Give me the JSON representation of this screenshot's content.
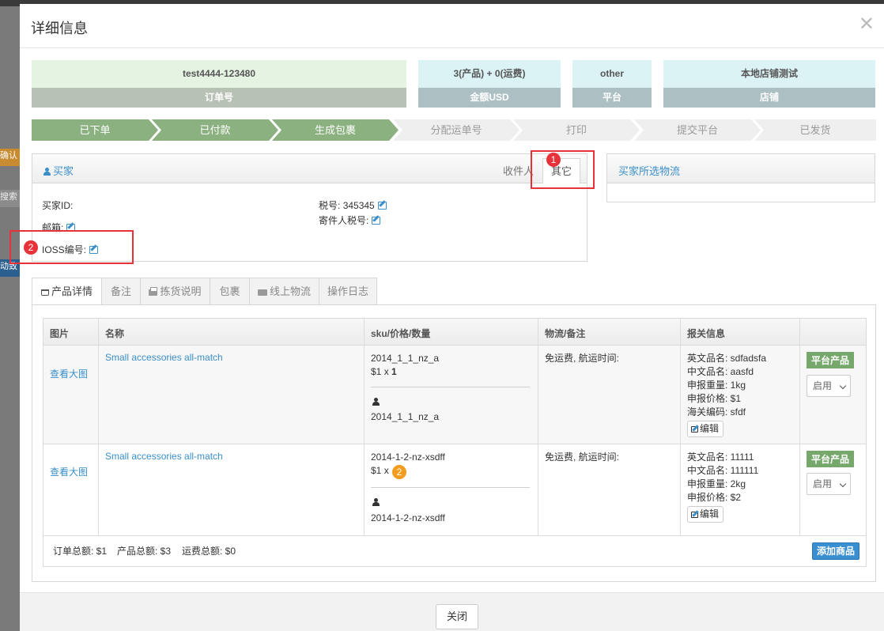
{
  "backdrop": {
    "side_items": [
      "确认",
      "搜索",
      "动致"
    ]
  },
  "modal": {
    "title": "详细信息",
    "close_symbol": "✕"
  },
  "summary": [
    {
      "value": "test4444-123480",
      "label": "订单号"
    },
    {
      "value": "3(产品) + 0(运费)",
      "label": "金额USD"
    },
    {
      "value": "other",
      "label": "平台"
    },
    {
      "value": "本地店铺测试",
      "label": "店铺"
    }
  ],
  "steps": [
    "已下单",
    "已付款",
    "生成包裹",
    "分配运单号",
    "打印",
    "提交平台",
    "已发货"
  ],
  "buyer": {
    "title": "买家",
    "tabs": [
      "收件人",
      "其它"
    ],
    "fields": {
      "buyer_id": "买家ID:",
      "email": "邮箱:",
      "ioss": "IOSS编号:",
      "tax_no_label": "税号:",
      "tax_no_value": "345345",
      "sender_tax": "寄件人税号:"
    }
  },
  "logistics_panel": {
    "title": "买家所选物流"
  },
  "annotations": {
    "badge1": "1",
    "badge2": "2",
    "badge3": "2"
  },
  "tabs": [
    "产品详情",
    "备注",
    "拣货说明",
    "包裹",
    "线上物流",
    "操作日志"
  ],
  "table": {
    "headers": [
      "图片",
      "名称",
      "sku/价格/数量",
      "物流/备注",
      "报关信息",
      ""
    ],
    "rows": [
      {
        "image_link": "查看大图",
        "name": "Small accessories all-match",
        "sku": "2014_1_1_nz_a",
        "price": "$1",
        "times": "x",
        "qty": "1",
        "buyer_sku": "2014_1_1_nz_a",
        "logistics": "免运费, 航运时间:",
        "customs": [
          "英文品名: sdfadsfa",
          "中文品名: aasfd",
          "申报重量: 1kg",
          "申报价格: $1",
          "海关编码: sfdf"
        ],
        "edit": "编辑",
        "platform_label": "平台产品",
        "status": "启用"
      },
      {
        "image_link": "查看大图",
        "name": "Small accessories all-match",
        "sku": "2014-1-2-nz-xsdff",
        "price": "$1",
        "times": "x",
        "qty": "",
        "buyer_sku": "2014-1-2-nz-xsdff",
        "logistics": "免运费, 航运时间:",
        "customs": [
          "英文品名: 11111",
          "中文品名: 111111",
          "申报重量: 2kg",
          "申报价格: $2"
        ],
        "edit": "编辑",
        "platform_label": "平台产品",
        "status": "启用"
      }
    ],
    "totals": {
      "order": "订单总额: $1",
      "product": "产品总额: $3",
      "shipping": "运费总额: $0"
    },
    "add_button": "添加商品"
  },
  "footer": {
    "close_button": "关闭"
  }
}
